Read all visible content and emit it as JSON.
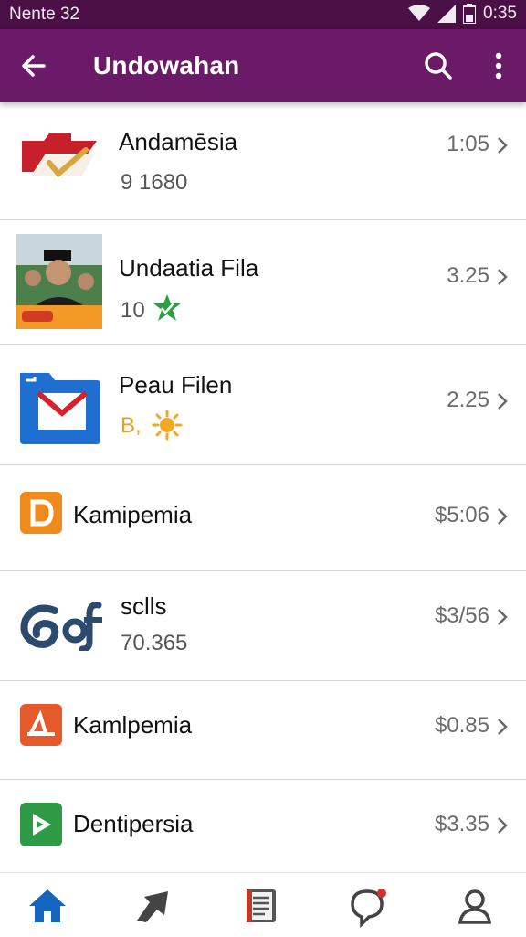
{
  "status_bar": {
    "carrier": "Nente 32",
    "time": "0:35"
  },
  "app_bar": {
    "title": "Undowahan",
    "back_icon": "arrow-back-icon",
    "search_icon": "search-icon",
    "more_icon": "more-vert-icon"
  },
  "colors": {
    "status_bar": "#4a0f44",
    "app_bar": "#6b1a68",
    "nav_active": "#1565c0",
    "divider": "#d4d4d4"
  },
  "items": [
    {
      "title": "Andamēsia",
      "subtitle": "9 1680",
      "meta": "1:05",
      "icon": "red-check-folder-icon"
    },
    {
      "title": "Undaatia Fila",
      "subtitle": "10",
      "meta": "3.25",
      "icon": "photo-thumbnail",
      "badge_icon": "green-star-badge-icon"
    },
    {
      "title": "Peau Filen",
      "subtitle": "B,",
      "meta": "2.25",
      "icon": "blue-mail-folder-icon",
      "badge_icon": "sun-icon"
    },
    {
      "title": "Kamipemia",
      "subtitle": "",
      "meta": "$5:06",
      "icon": "orange-d-app-icon"
    },
    {
      "title": "sclls",
      "subtitle": "70.365",
      "meta": "$3/56",
      "icon": "blue-spiral-logo-icon"
    },
    {
      "title": "Kamlpemia",
      "subtitle": "",
      "meta": "$0.85",
      "icon": "orange-a-app-icon"
    },
    {
      "title": "Dentipersia",
      "subtitle": "",
      "meta": "$3.35",
      "icon": "green-play-app-icon"
    }
  ],
  "bottom_nav": [
    {
      "icon": "home-icon",
      "active": true
    },
    {
      "icon": "share-arrow-icon",
      "active": false
    },
    {
      "icon": "book-icon",
      "active": false
    },
    {
      "icon": "notification-bubble-icon",
      "active": false
    },
    {
      "icon": "profile-icon",
      "active": false
    }
  ]
}
